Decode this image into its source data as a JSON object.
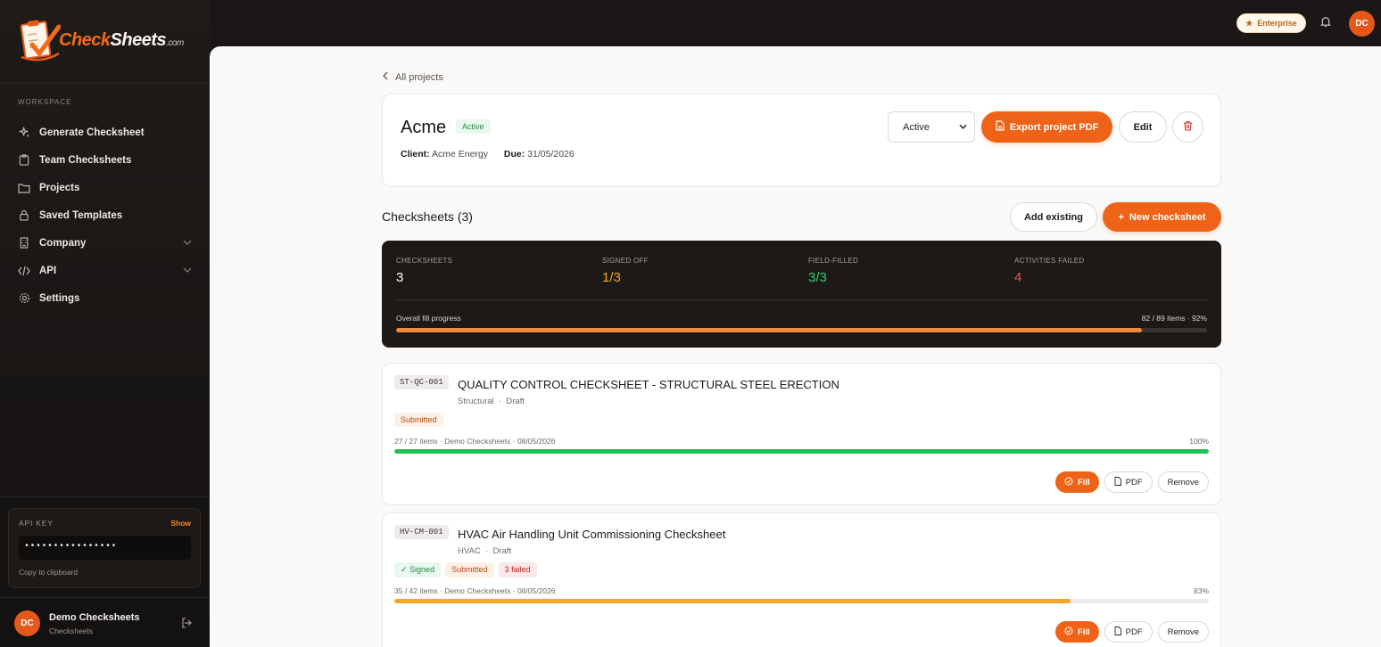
{
  "brand": {
    "name_a": "Check",
    "name_b": "Sheets",
    "name_c": ".com"
  },
  "sidebar": {
    "section": "WORKSPACE",
    "items": [
      {
        "label": "Generate Checksheet",
        "icon": "sparkle-icon"
      },
      {
        "label": "Team Checksheets",
        "icon": "clipboard-icon"
      },
      {
        "label": "Projects",
        "icon": "folder-icon"
      },
      {
        "label": "Saved Templates",
        "icon": "lock-icon"
      },
      {
        "label": "Company",
        "icon": "building-icon",
        "has_children": true
      },
      {
        "label": "API",
        "icon": "code-icon",
        "has_children": true
      },
      {
        "label": "Settings",
        "icon": "gear-icon"
      }
    ],
    "api_key": {
      "title": "API KEY",
      "show_label": "Show",
      "value": "••••••••••••••••",
      "copy_label": "Copy to clipboard"
    },
    "user": {
      "initials": "DC",
      "name": "Demo Checksheets",
      "org": "Checksheets"
    }
  },
  "topbar": {
    "plan_label": "Enterprise",
    "avatar_initials": "DC"
  },
  "breadcrumb": {
    "back_label": "All projects"
  },
  "project": {
    "title": "Acme",
    "status_badge": "Active",
    "client_label": "Client:",
    "client_value": "Acme Energy",
    "due_label": "Due:",
    "due_value": "31/05/2026",
    "status_select": "Active",
    "export_label": "Export project PDF",
    "edit_label": "Edit"
  },
  "checksheets_section": {
    "title": "Checksheets (3)",
    "add_existing_label": "Add existing",
    "new_label": "New checksheet"
  },
  "stats": {
    "items": [
      {
        "key": "CHECKSHEETS",
        "value": "3",
        "color": "#ffffff"
      },
      {
        "key": "SIGNED OFF",
        "value": "1/3",
        "color": "#f5a623"
      },
      {
        "key": "FIELD-FILLED",
        "value": "3/3",
        "color": "#2fd06b"
      },
      {
        "key": "ACTIVITIES FAILED",
        "value": "4",
        "color": "#f05252"
      }
    ],
    "progress_label": "Overall fill progress",
    "progress_text": "82 / 89 items · 92%",
    "progress_fraction": 0.92
  },
  "checksheets": [
    {
      "code": "ST-QC-001",
      "title": "QUALITY CONTROL CHECKSHEET - STRUCTURAL STEEL ERECTION",
      "category": "Structural",
      "state": "Draft",
      "pills": [
        {
          "label": "Submitted",
          "kind": "submitted"
        }
      ],
      "meta": "27 / 27 items · Demo Checksheets · 08/05/2026",
      "pct_label": "100%",
      "progress_fraction": 1.0,
      "bar_color": "#1fbf55",
      "fill_label": "Fill",
      "pdf_label": "PDF",
      "remove_label": "Remove"
    },
    {
      "code": "HV-CM-001",
      "title": "HVAC Air Handling Unit Commissioning Checksheet",
      "category": "HVAC",
      "state": "Draft",
      "pills": [
        {
          "label": "Signed",
          "kind": "signed"
        },
        {
          "label": "Submitted",
          "kind": "submitted"
        },
        {
          "label": "3 failed",
          "kind": "failed"
        }
      ],
      "meta": "35 / 42 items · Demo Checksheets · 08/05/2026",
      "pct_label": "83%",
      "progress_fraction": 0.83,
      "bar_color": "#f5a623",
      "fill_label": "Fill",
      "pdf_label": "PDF",
      "remove_label": "Remove"
    }
  ]
}
